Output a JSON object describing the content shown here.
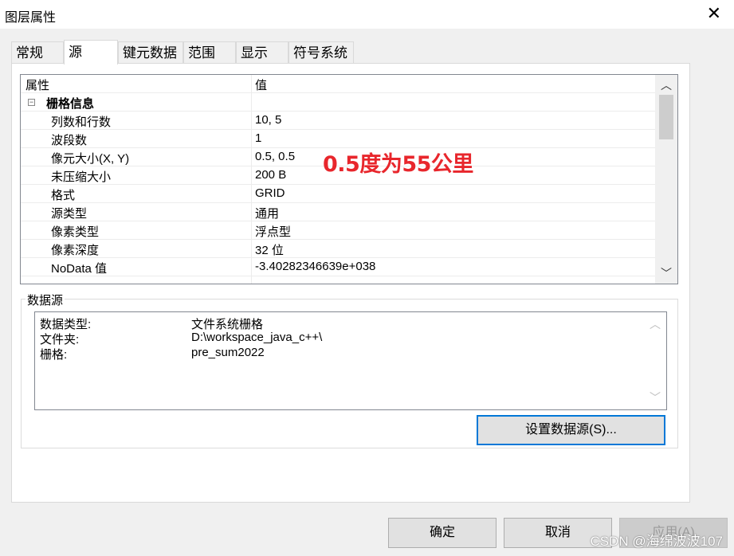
{
  "window": {
    "title": "图层属性",
    "close_glyph": "✕"
  },
  "tabs": [
    {
      "label": "常规"
    },
    {
      "label": "源",
      "active": true
    },
    {
      "label": "键元数据"
    },
    {
      "label": "范围"
    },
    {
      "label": "显示"
    },
    {
      "label": "符号系统"
    }
  ],
  "grid": {
    "header": {
      "property": "属性",
      "value": "值"
    },
    "group_label": "栅格信息",
    "rows": [
      {
        "property": "列数和行数",
        "value": "10, 5"
      },
      {
        "property": "波段数",
        "value": "1"
      },
      {
        "property": "像元大小(X, Y)",
        "value": "0.5, 0.5"
      },
      {
        "property": "未压缩大小",
        "value": "200 B"
      },
      {
        "property": "格式",
        "value": "GRID"
      },
      {
        "property": "源类型",
        "value": "通用"
      },
      {
        "property": "像素类型",
        "value": "浮点型"
      },
      {
        "property": "像素深度",
        "value": "32 位"
      },
      {
        "property": "NoData 值",
        "value": "-3.40282346639e+038"
      }
    ],
    "annotation": "0.5度为55公里",
    "annotation_color": "#e8262c"
  },
  "datasource": {
    "title": "数据源",
    "lines": [
      {
        "key": "数据类型:",
        "value": "文件系统栅格"
      },
      {
        "key": "文件夹:",
        "value": "D:\\workspace_java_c++\\"
      },
      {
        "key": "栅格:",
        "value": "pre_sum2022"
      }
    ],
    "set_button": "设置数据源(S)..."
  },
  "footer": {
    "ok": "确定",
    "cancel": "取消",
    "apply": "应用(A)",
    "watermark": "CSDN @海绵波波107"
  },
  "colors": {
    "accent": "#0078d7",
    "annotation": "#e8262c"
  }
}
